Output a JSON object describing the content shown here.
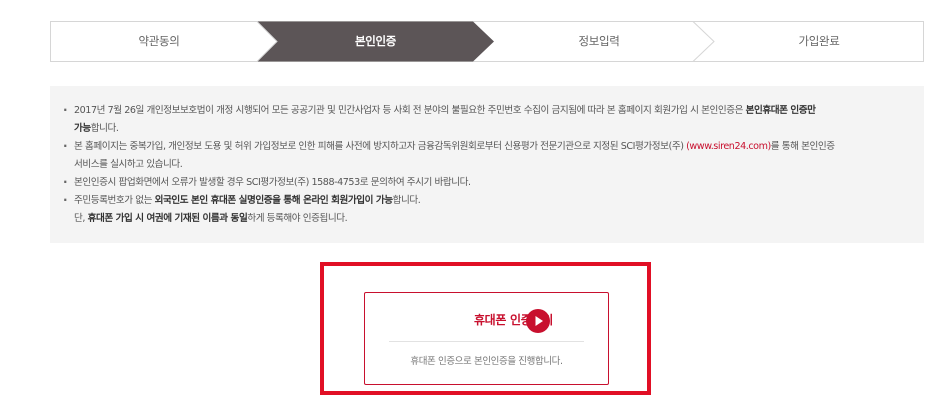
{
  "steps": [
    {
      "label": "약관동의",
      "active": false
    },
    {
      "label": "본인인증",
      "active": true
    },
    {
      "label": "정보입력",
      "active": false
    },
    {
      "label": "가입완료",
      "active": false
    }
  ],
  "colors": {
    "active_step": "#5c5557",
    "accent": "#c8102e",
    "highlight_border": "#e10f25",
    "notice_bg": "#f4f4f4"
  },
  "notice": {
    "item1": {
      "line1_text": "2017년 7월 26일 개인정보보호법이 개정 시행되어 모든 공공기관 및 민간사업자 등 사회 전 분야의 불필요한 주민번호 수집이 금지됨에 따라 본 홈페이지 회원가입 시 본인인증은 ",
      "line1_bold": "본인휴대폰 인증만",
      "line2_bold": "가능",
      "line2_text": "합니다."
    },
    "item2": {
      "line1_text": "본 홈페이지는 중복가입, 개인정보 도용 및 허위 가입정보로 인한 피해를 사전에 방지하고자 금융감독위원회로부터 신용평가 전문기관으로 지정된 SCI평가정보(주) ",
      "line1_link": "(www.siren24.com)",
      "line1_after": "를 통해 본인인증",
      "line2_text": "서비스를 실시하고 있습니다."
    },
    "item3": {
      "text": "본인인증시 팝업화면에서 오류가 발생할 경우 SCI평가정보(주) 1588-4753로 문의하여 주시기 바랍니다."
    },
    "item4": {
      "line1_pre": "주민등록번호가 없는 ",
      "line1_bold": "외국인도 본인 휴대폰 실명인증을 통해 온라인 회원가입이 가능",
      "line1_post": "합니다.",
      "line2_pre": "단, ",
      "line2_bold1": "휴대폰 가입 시 여권에 기재된 이름과 동일",
      "line2_post": "하게 등록해야 인증됩니다."
    }
  },
  "phone_auth": {
    "title": "휴대폰 인증하기",
    "icon": "play-circle-icon",
    "description": "휴대폰 인증으로 본인인증을 진행합니다."
  }
}
